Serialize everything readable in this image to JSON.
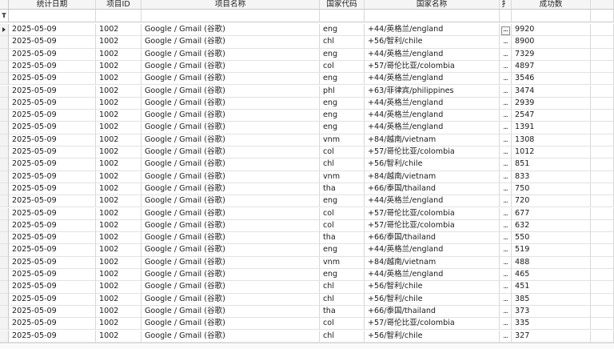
{
  "columns": {
    "date": "统计日期",
    "project_id": "项目ID",
    "project_name": "项目名称",
    "country_code": "国家代码",
    "country_name": "国家名称",
    "narrow": "扌",
    "success_count": "成功数"
  },
  "row_ellipsis": "...",
  "rows": [
    {
      "date": "2025-05-09",
      "project_id": "1002",
      "project_name": "Google / Gmail (谷歌)",
      "country_code": "eng",
      "country_name": "+44/英格兰/england",
      "success_count": "9920"
    },
    {
      "date": "2025-05-09",
      "project_id": "1002",
      "project_name": "Google / Gmail (谷歌)",
      "country_code": "chl",
      "country_name": "+56/智利/chile",
      "success_count": "8900"
    },
    {
      "date": "2025-05-09",
      "project_id": "1002",
      "project_name": "Google / Gmail (谷歌)",
      "country_code": "eng",
      "country_name": "+44/英格兰/england",
      "success_count": "7329"
    },
    {
      "date": "2025-05-09",
      "project_id": "1002",
      "project_name": "Google / Gmail (谷歌)",
      "country_code": "col",
      "country_name": "+57/哥伦比亚/colombia",
      "success_count": "4897"
    },
    {
      "date": "2025-05-09",
      "project_id": "1002",
      "project_name": "Google / Gmail (谷歌)",
      "country_code": "eng",
      "country_name": "+44/英格兰/england",
      "success_count": "3546"
    },
    {
      "date": "2025-05-09",
      "project_id": "1002",
      "project_name": "Google / Gmail (谷歌)",
      "country_code": "phl",
      "country_name": "+63/菲律宾/philippines",
      "success_count": "3474"
    },
    {
      "date": "2025-05-09",
      "project_id": "1002",
      "project_name": "Google / Gmail (谷歌)",
      "country_code": "eng",
      "country_name": "+44/英格兰/england",
      "success_count": "2939"
    },
    {
      "date": "2025-05-09",
      "project_id": "1002",
      "project_name": "Google / Gmail (谷歌)",
      "country_code": "eng",
      "country_name": "+44/英格兰/england",
      "success_count": "2547"
    },
    {
      "date": "2025-05-09",
      "project_id": "1002",
      "project_name": "Google / Gmail (谷歌)",
      "country_code": "eng",
      "country_name": "+44/英格兰/england",
      "success_count": "1391"
    },
    {
      "date": "2025-05-09",
      "project_id": "1002",
      "project_name": "Google / Gmail (谷歌)",
      "country_code": "vnm",
      "country_name": "+84/越南/vietnam",
      "success_count": "1308"
    },
    {
      "date": "2025-05-09",
      "project_id": "1002",
      "project_name": "Google / Gmail (谷歌)",
      "country_code": "col",
      "country_name": "+57/哥伦比亚/colombia",
      "success_count": "1012"
    },
    {
      "date": "2025-05-09",
      "project_id": "1002",
      "project_name": "Google / Gmail (谷歌)",
      "country_code": "chl",
      "country_name": "+56/智利/chile",
      "success_count": "851"
    },
    {
      "date": "2025-05-09",
      "project_id": "1002",
      "project_name": "Google / Gmail (谷歌)",
      "country_code": "vnm",
      "country_name": "+84/越南/vietnam",
      "success_count": "833"
    },
    {
      "date": "2025-05-09",
      "project_id": "1002",
      "project_name": "Google / Gmail (谷歌)",
      "country_code": "tha",
      "country_name": "+66/泰国/thailand",
      "success_count": "750"
    },
    {
      "date": "2025-05-09",
      "project_id": "1002",
      "project_name": "Google / Gmail (谷歌)",
      "country_code": "eng",
      "country_name": "+44/英格兰/england",
      "success_count": "720"
    },
    {
      "date": "2025-05-09",
      "project_id": "1002",
      "project_name": "Google / Gmail (谷歌)",
      "country_code": "col",
      "country_name": "+57/哥伦比亚/colombia",
      "success_count": "677"
    },
    {
      "date": "2025-05-09",
      "project_id": "1002",
      "project_name": "Google / Gmail (谷歌)",
      "country_code": "col",
      "country_name": "+57/哥伦比亚/colombia",
      "success_count": "632"
    },
    {
      "date": "2025-05-09",
      "project_id": "1002",
      "project_name": "Google / Gmail (谷歌)",
      "country_code": "tha",
      "country_name": "+66/泰国/thailand",
      "success_count": "550"
    },
    {
      "date": "2025-05-09",
      "project_id": "1002",
      "project_name": "Google / Gmail (谷歌)",
      "country_code": "eng",
      "country_name": "+44/英格兰/england",
      "success_count": "519"
    },
    {
      "date": "2025-05-09",
      "project_id": "1002",
      "project_name": "Google / Gmail (谷歌)",
      "country_code": "vnm",
      "country_name": "+84/越南/vietnam",
      "success_count": "488"
    },
    {
      "date": "2025-05-09",
      "project_id": "1002",
      "project_name": "Google / Gmail (谷歌)",
      "country_code": "eng",
      "country_name": "+44/英格兰/england",
      "success_count": "465"
    },
    {
      "date": "2025-05-09",
      "project_id": "1002",
      "project_name": "Google / Gmail (谷歌)",
      "country_code": "chl",
      "country_name": "+56/智利/chile",
      "success_count": "451"
    },
    {
      "date": "2025-05-09",
      "project_id": "1002",
      "project_name": "Google / Gmail (谷歌)",
      "country_code": "chl",
      "country_name": "+56/智利/chile",
      "success_count": "385"
    },
    {
      "date": "2025-05-09",
      "project_id": "1002",
      "project_name": "Google / Gmail (谷歌)",
      "country_code": "tha",
      "country_name": "+66/泰国/thailand",
      "success_count": "373"
    },
    {
      "date": "2025-05-09",
      "project_id": "1002",
      "project_name": "Google / Gmail (谷歌)",
      "country_code": "col",
      "country_name": "+57/哥伦比亚/colombia",
      "success_count": "335"
    },
    {
      "date": "2025-05-09",
      "project_id": "1002",
      "project_name": "Google / Gmail (谷歌)",
      "country_code": "chl",
      "country_name": "+56/智利/chile",
      "success_count": "327"
    }
  ]
}
